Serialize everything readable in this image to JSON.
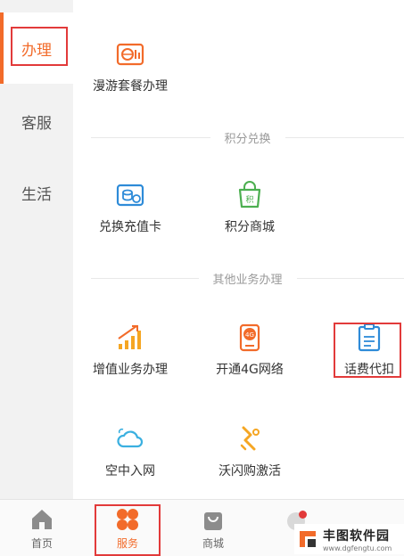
{
  "sidebar": {
    "items": [
      {
        "label": "办理",
        "active": true
      },
      {
        "label": "客服",
        "active": false
      },
      {
        "label": "生活",
        "active": false
      }
    ]
  },
  "sections": {
    "roaming": {
      "label": "漫游套餐办理",
      "icon": "roaming-package-icon"
    },
    "points_header": "积分兑换",
    "points": [
      {
        "label": "兑换充值卡",
        "icon": "recharge-card-icon"
      },
      {
        "label": "积分商城",
        "icon": "points-mall-icon"
      }
    ],
    "other_header": "其他业务办理",
    "other": [
      {
        "label": "增值业务办理",
        "icon": "value-added-icon"
      },
      {
        "label": "开通4G网络",
        "icon": "open-4g-icon"
      },
      {
        "label": "话费代扣",
        "icon": "auto-deduct-icon"
      },
      {
        "label": "空中入网",
        "icon": "cloud-network-icon"
      },
      {
        "label": "沃闪购激活",
        "icon": "wo-flash-activate-icon"
      }
    ]
  },
  "bottom_nav": [
    {
      "label": "首页",
      "icon": "home-icon"
    },
    {
      "label": "服务",
      "icon": "service-icon",
      "active": true
    },
    {
      "label": "商城",
      "icon": "mall-icon"
    }
  ],
  "watermark": {
    "title": "丰图软件园",
    "url": "www.dgfengtu.com"
  },
  "colors": {
    "accent": "#f26b2a",
    "highlight": "#e23a3a",
    "blue": "#2e8bd8",
    "green": "#4caf50"
  }
}
